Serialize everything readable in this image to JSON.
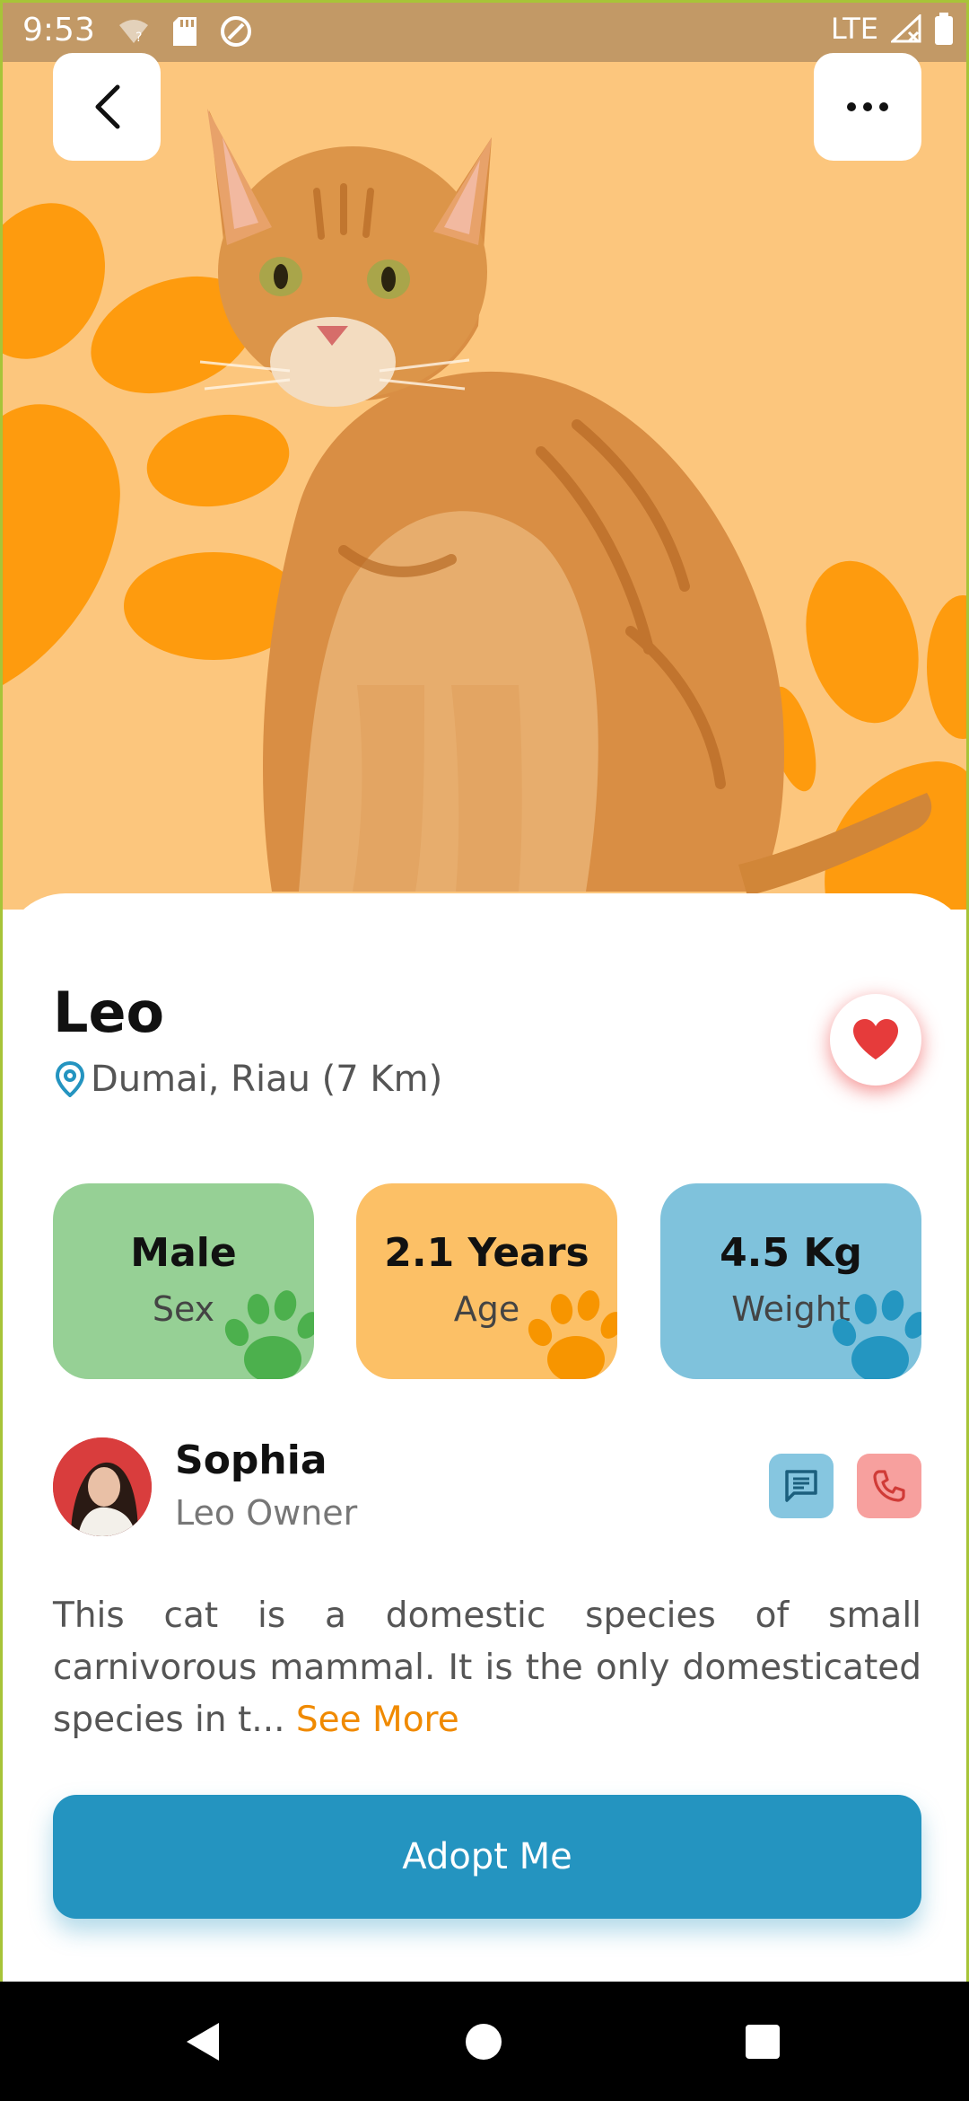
{
  "status_bar": {
    "time": "9:53",
    "network": "LTE"
  },
  "header": {
    "back_icon": "chevron-left-icon",
    "more_icon": "more-horizontal-icon"
  },
  "pet": {
    "name": "Leo",
    "location": "Dumai, Riau (7 Km)",
    "favorite": true,
    "stats": [
      {
        "value": "Male",
        "label": "Sex",
        "bg": "#96d095",
        "paw": "#4cb04d"
      },
      {
        "value": "2.1 Years",
        "label": "Age",
        "bg": "#fcc066",
        "paw": "#f79500"
      },
      {
        "value": "4.5 Kg",
        "label": "Weight",
        "bg": "#7fc2dc",
        "paw": "#2496c1"
      }
    ]
  },
  "owner": {
    "name": "Sophia",
    "role": "Leo Owner"
  },
  "description": {
    "text": "This cat is a domestic species of small carnivorous mammal. It is the only domesticated species in t...",
    "see_more": "See More"
  },
  "adopt_button": {
    "label": "Adopt Me"
  },
  "colors": {
    "accent": "#2494c0",
    "hero_bg": "#fcc67d",
    "paw_orange": "#fe9b0e",
    "heart": "#e63b3b"
  }
}
